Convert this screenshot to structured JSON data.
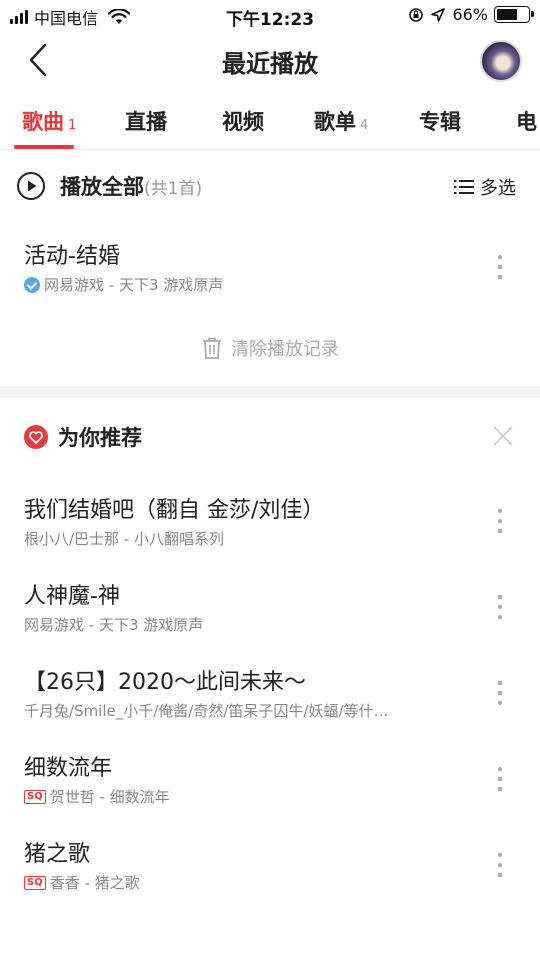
{
  "status_bar": {
    "carrier": "中国电信",
    "time": "下午12:23",
    "battery_percent": "66%",
    "battery_level": 0.66
  },
  "header": {
    "title": "最近播放"
  },
  "tabs": [
    {
      "label": "歌曲",
      "count": "1",
      "active": true
    },
    {
      "label": "直播",
      "count": ""
    },
    {
      "label": "视频",
      "count": ""
    },
    {
      "label": "歌单",
      "count": "4"
    },
    {
      "label": "专辑",
      "count": ""
    },
    {
      "label": "电",
      "count": ""
    }
  ],
  "play_all": {
    "label": "播放全部",
    "count": "(共1首)",
    "multiselect_label": "多选"
  },
  "recent_songs": [
    {
      "title": "活动-结婚",
      "subtitle": "网易游戏 - 天下3 游戏原声",
      "badge": "verified"
    }
  ],
  "clear_history": "清除播放记录",
  "recommend": {
    "title": "为你推荐",
    "songs": [
      {
        "title": "我们结婚吧（翻自 金莎/刘佳）",
        "subtitle": "根小八/巴士那 - 小八翻唱系列",
        "badge": ""
      },
      {
        "title": "人神魔-神",
        "subtitle": "网易游戏 - 天下3 游戏原声",
        "badge": ""
      },
      {
        "title": "【26只】2020～此间未来～",
        "subtitle": "千月兔/Smile_小千/俺酱/奇然/笛呆子囚牛/妖蝠/等什…",
        "badge": ""
      },
      {
        "title": "细数流年",
        "subtitle": "贺世哲 - 细数流年",
        "badge": "SQ"
      },
      {
        "title": "猪之歌",
        "subtitle": "香香 - 猪之歌",
        "badge": "SQ"
      }
    ]
  },
  "colors": {
    "accent": "#e8373d",
    "muted_text": "#888888",
    "verified_blue": "#5aa7e8"
  }
}
